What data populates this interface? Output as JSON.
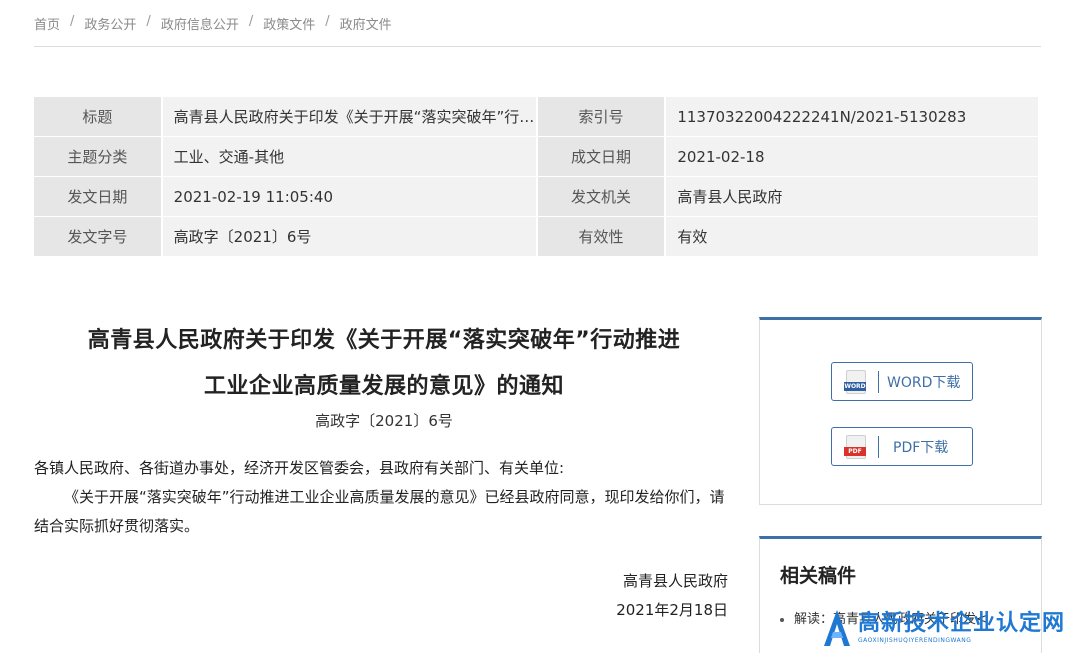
{
  "breadcrumb": [
    "首页",
    "政务公开",
    "政府信息公开",
    "政策文件",
    "政府文件"
  ],
  "meta": {
    "rows": [
      {
        "k1": "标题",
        "v1": "高青县人民政府关于印发《关于开展“落实突破年”行动推进工业企业高质量发展的意见》的通知",
        "k2": "索引号",
        "v2": "11370322004222241N/2021-5130283"
      },
      {
        "k1": "主题分类",
        "v1": "工业、交通-其他",
        "k2": "成文日期",
        "v2": "2021-02-18"
      },
      {
        "k1": "发文日期",
        "v1": "2021-02-19 11:05:40",
        "k2": "发文机关",
        "v2": "高青县人民政府"
      },
      {
        "k1": "发文字号",
        "v1": "高政字〔2021〕6号",
        "k2": "有效性",
        "v2": "有效"
      }
    ]
  },
  "article": {
    "title_line1": "高青县人民政府关于印发《关于开展“落实突破年”行动推进",
    "title_line2": "工业企业高质量发展的意见》的通知",
    "doc_no": "高政字〔2021〕6号",
    "salutation": "各镇人民政府、各街道办事处，经济开发区管委会，县政府有关部门、有关单位:",
    "paragraph": "《关于开展“落实突破年”行动推进工业企业高质量发展的意见》已经县政府同意，现印发给你们，请结合实际抓好贯彻落实。",
    "signer": "高青县人民政府",
    "date": "2021年2月18日"
  },
  "downloads": {
    "word_label": "WORD下载",
    "word_tag": "WORD",
    "pdf_label": "PDF下载",
    "pdf_tag": "PDF",
    "accent": "#3f6fa7"
  },
  "related": {
    "heading": "相关稿件",
    "items": [
      "解读：高青县人民政府关于印发<"
    ]
  },
  "watermark": {
    "big": "高新技术企业认定网",
    "small": "GAOXINJISHUQIYERENDINGWANG",
    "color": "#1f78d1"
  }
}
